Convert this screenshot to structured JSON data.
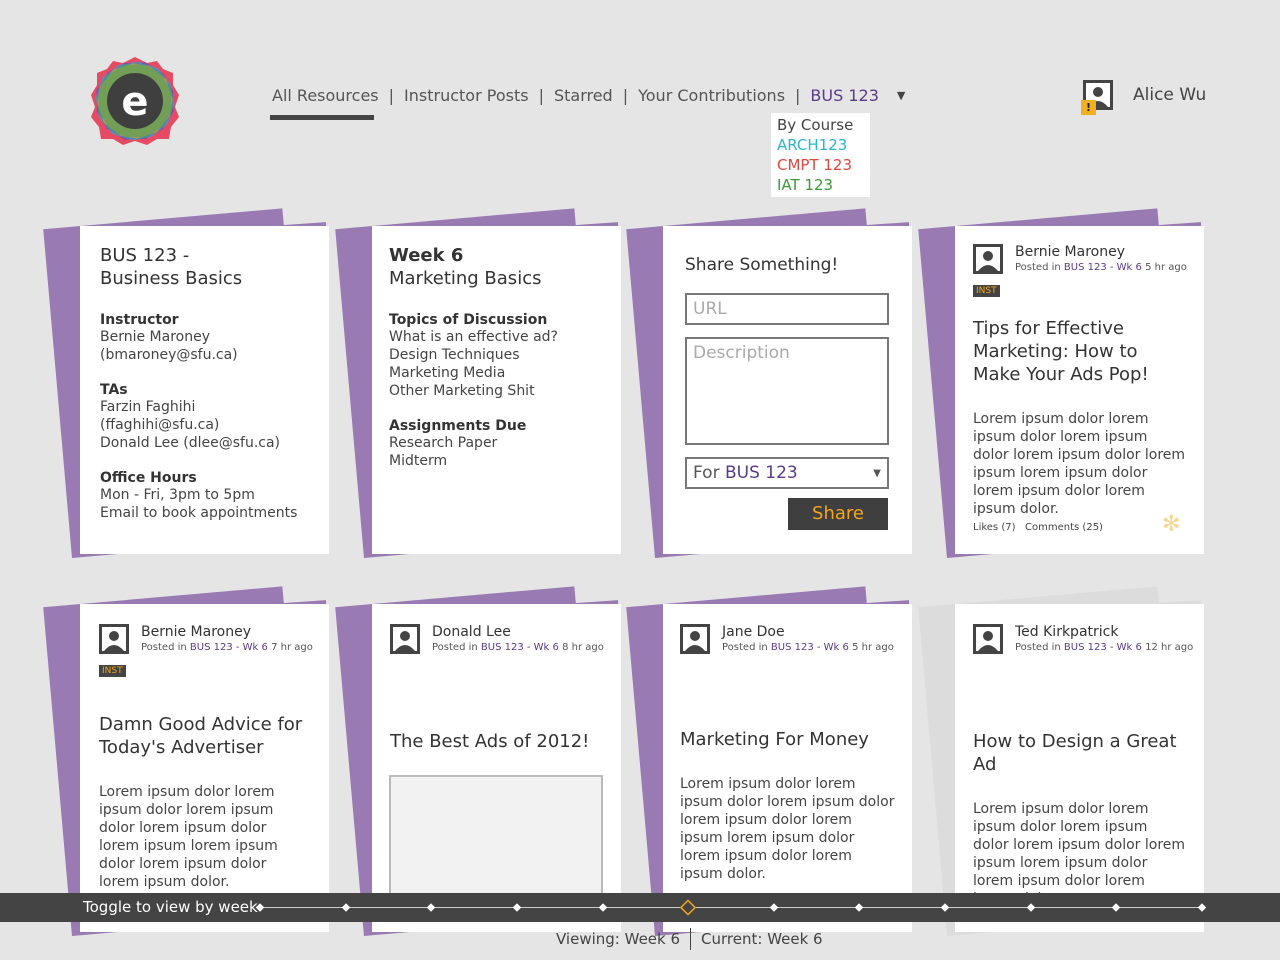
{
  "app": {
    "logo_letter": "e"
  },
  "nav": {
    "items": [
      "All Resources",
      "Instructor Posts",
      "Starred",
      "Your Contributions"
    ],
    "course": "BUS 123",
    "dropdown": {
      "title": "By Course",
      "options": [
        {
          "label": "ARCH123",
          "color": "#2bb5c8"
        },
        {
          "label": "CMPT 123",
          "color": "#e0463c"
        },
        {
          "label": "IAT 123",
          "color": "#3a9a3a"
        }
      ]
    }
  },
  "user": {
    "name": "Alice Wu",
    "warning": "!"
  },
  "course_card": {
    "title_line1": "BUS 123 -",
    "title_line2": "Business Basics",
    "instructor_label": "Instructor",
    "instructor_name": "Bernie Maroney",
    "instructor_email": "(bmaroney@sfu.ca)",
    "tas_label": "TAs",
    "ta1": "Farzin Faghihi (ffaghihi@sfu.ca)",
    "ta2": "Donald Lee (dlee@sfu.ca)",
    "office_label": "Office Hours",
    "office1": "Mon - Fri, 3pm to 5pm",
    "office2": "Email to book appointments"
  },
  "week_card": {
    "title_line1": "Week 6",
    "title_line2": "Marketing Basics",
    "topics_label": "Topics of Discussion",
    "topics": [
      "What is an effective ad?",
      "Design Techniques",
      "Marketing Media",
      "Other Marketing Shit"
    ],
    "assign_label": "Assignments Due",
    "assignments": [
      "Research Paper",
      "Midterm"
    ]
  },
  "share_card": {
    "title": "Share Something!",
    "url_placeholder": "URL",
    "desc_placeholder": "Description",
    "for_label": "For",
    "for_course": "BUS 123",
    "button": "Share"
  },
  "posts": [
    {
      "author": "Bernie Maroney",
      "posted_prefix": "Posted in",
      "course": "BUS 123 - Wk 6",
      "ago": "5 hr ago",
      "badge": "INST",
      "title": "Tips for Effective Marketing: How to Make Your Ads Pop!",
      "body": "Lorem ipsum dolor lorem ipsum dolor lorem ipsum dolor lorem ipsum dolor lorem ipsum lorem ipsum dolor lorem ipsum dolor lorem ipsum dolor.",
      "likes": "Likes (7)",
      "comments": "Comments (25)"
    },
    {
      "author": "Bernie Maroney",
      "posted_prefix": "Posted in",
      "course": "BUS 123 - Wk 6",
      "ago": "7 hr ago",
      "badge": "INST",
      "title": "Damn Good Advice for Today's Advertiser",
      "body": "Lorem ipsum dolor lorem ipsum dolor lorem ipsum dolor lorem ipsum dolor lorem ipsum lorem ipsum dolor lorem ipsum dolor lorem ipsum dolor."
    },
    {
      "author": "Donald Lee",
      "posted_prefix": "Posted in",
      "course": "BUS 123 - Wk 6",
      "ago": "8 hr ago",
      "title": "The Best Ads of 2012!"
    },
    {
      "author": "Jane Doe",
      "posted_prefix": "Posted in",
      "course": "BUS 123 - Wk 6",
      "ago": "5 hr ago",
      "title": "Marketing For Money",
      "body": "Lorem ipsum dolor lorem ipsum dolor lorem ipsum dolor lorem ipsum dolor lorem ipsum lorem ipsum dolor lorem ipsum dolor lorem ipsum dolor."
    },
    {
      "author": "Ted Kirkpatrick",
      "posted_prefix": "Posted in",
      "course": "BUS 123 - Wk 6",
      "ago": "12 hr ago",
      "title": "How to Design a Great Ad",
      "body": "Lorem ipsum dolor lorem ipsum dolor lorem ipsum dolor lorem ipsum dolor lorem ipsum lorem ipsum dolor lorem ipsum dolor lorem ipsum dolor."
    }
  ],
  "timeline": {
    "label": "Toggle to view by week",
    "viewing": "Viewing: Week 6",
    "current": "Current: Week 6"
  },
  "colors": {
    "purple": "#9a7ab2",
    "course_text": "#5a3a8a",
    "accent": "#f3a51b",
    "bar": "#444444"
  }
}
